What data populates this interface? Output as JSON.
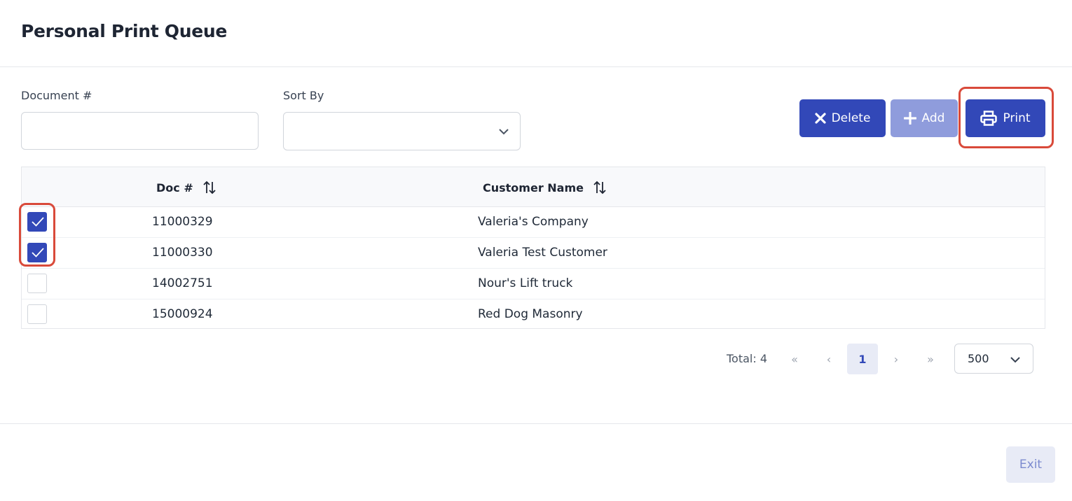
{
  "page": {
    "title": "Personal Print Queue"
  },
  "filters": {
    "document_label": "Document #",
    "document_value": "",
    "sort_label": "Sort By",
    "sort_value": ""
  },
  "toolbar": {
    "delete_label": "Delete",
    "add_label": "Add",
    "print_label": "Print"
  },
  "table": {
    "columns": [
      "Doc #",
      "Customer Name"
    ],
    "rows": [
      {
        "checked": true,
        "doc": "11000329",
        "customer": "Valeria's Company"
      },
      {
        "checked": true,
        "doc": "11000330",
        "customer": "Valeria Test Customer"
      },
      {
        "checked": false,
        "doc": "14002751",
        "customer": "Nour's Lift truck"
      },
      {
        "checked": false,
        "doc": "15000924",
        "customer": "Red Dog Masonry"
      }
    ]
  },
  "pagination": {
    "total_text": "Total: 4",
    "first": "«",
    "prev": "‹",
    "current_page": "1",
    "next": "›",
    "last": "»",
    "page_size": "500"
  },
  "footer": {
    "exit_label": "Exit"
  },
  "colors": {
    "primary": "#3248b8",
    "primary_disabled": "#8f9cdc",
    "highlight": "#d94a3a"
  }
}
